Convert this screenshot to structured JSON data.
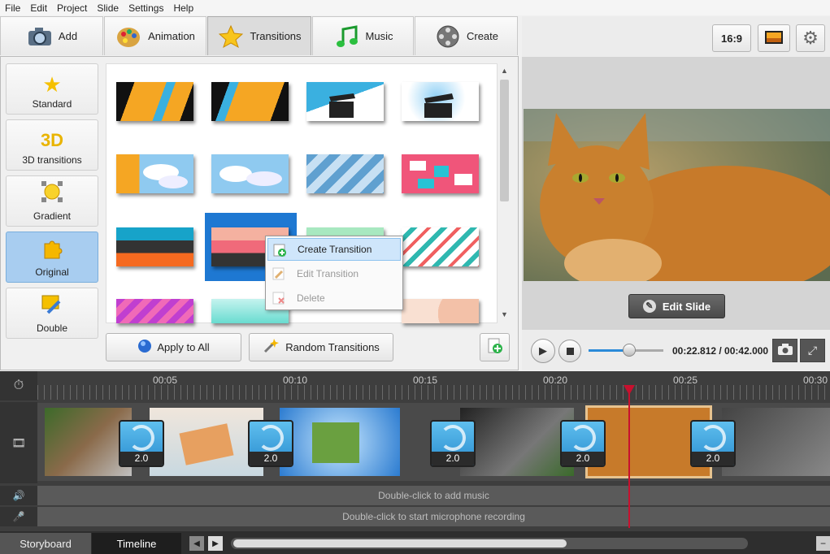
{
  "menu": [
    "File",
    "Edit",
    "Project",
    "Slide",
    "Settings",
    "Help"
  ],
  "tabs": {
    "add": "Add",
    "animation": "Animation",
    "transitions": "Transitions",
    "music": "Music",
    "create": "Create"
  },
  "categories": {
    "standard": "Standard",
    "three_d": "3D transitions",
    "three_d_badge": "3D",
    "gradient": "Gradient",
    "original": "Original",
    "double": "Double"
  },
  "context_menu": {
    "create": "Create Transition",
    "edit": "Edit Transition",
    "delete": "Delete"
  },
  "buttons": {
    "apply_all": "Apply to All",
    "random": "Random Transitions",
    "edit_slide": "Edit Slide",
    "aspect": "16:9"
  },
  "player": {
    "time": "00:22.812 / 00:42.000",
    "progress": 0.54
  },
  "timeline": {
    "ticks": [
      "00:05",
      "00:10",
      "00:15",
      "00:20",
      "00:25",
      "00:30"
    ],
    "transition_durations": [
      "2.0",
      "2.0",
      "2.0",
      "2.0",
      "2.0"
    ],
    "music_hint": "Double-click to add music",
    "mic_hint": "Double-click to start microphone recording"
  },
  "bottom_tabs": {
    "storyboard": "Storyboard",
    "timeline": "Timeline"
  },
  "colors": {
    "accent": "#1e78d2",
    "playhead": "#c8102e",
    "selected_category": "#a8cdf0"
  }
}
